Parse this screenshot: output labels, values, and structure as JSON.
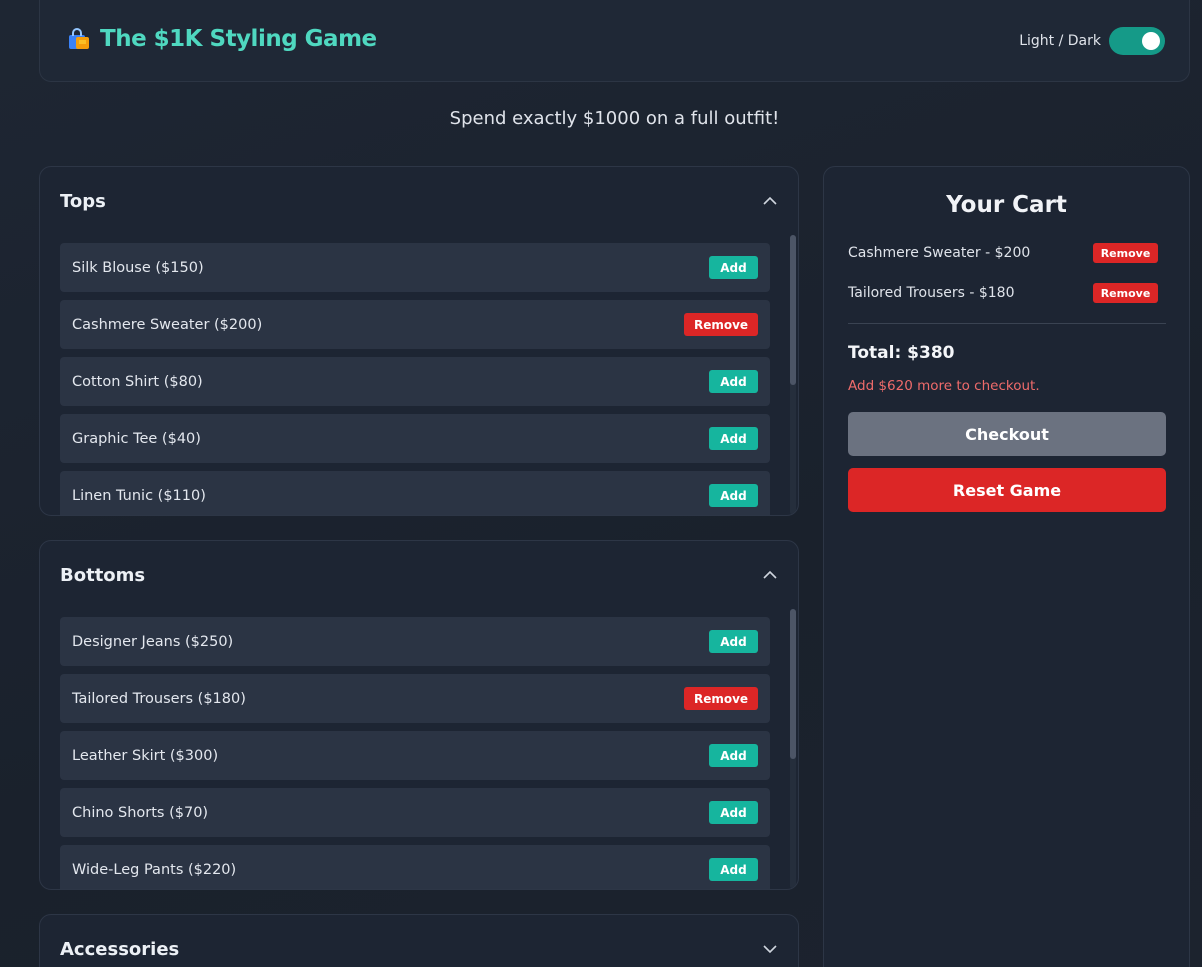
{
  "header": {
    "title": "The $1K Styling Game",
    "theme_label": "Light / Dark",
    "icon": "shopping-bag-icon"
  },
  "subtitle": "Spend exactly $1000 on a full outfit!",
  "categories": [
    {
      "title": "Tops",
      "expanded": true,
      "items": [
        {
          "label": "Silk Blouse ($150)",
          "action": "Add"
        },
        {
          "label": "Cashmere Sweater ($200)",
          "action": "Remove"
        },
        {
          "label": "Cotton Shirt ($80)",
          "action": "Add"
        },
        {
          "label": "Graphic Tee ($40)",
          "action": "Add"
        },
        {
          "label": "Linen Tunic ($110)",
          "action": "Add"
        }
      ]
    },
    {
      "title": "Bottoms",
      "expanded": true,
      "items": [
        {
          "label": "Designer Jeans ($250)",
          "action": "Add"
        },
        {
          "label": "Tailored Trousers ($180)",
          "action": "Remove"
        },
        {
          "label": "Leather Skirt ($300)",
          "action": "Add"
        },
        {
          "label": "Chino Shorts ($70)",
          "action": "Add"
        },
        {
          "label": "Wide-Leg Pants ($220)",
          "action": "Add"
        }
      ]
    },
    {
      "title": "Accessories",
      "expanded": false,
      "items": []
    }
  ],
  "cart": {
    "title": "Your Cart",
    "items": [
      {
        "label": "Cashmere Sweater - $200",
        "action": "Remove"
      },
      {
        "label": "Tailored Trousers - $180",
        "action": "Remove"
      }
    ],
    "total": "Total: $380",
    "warning": "Add $620 more to checkout.",
    "checkout_label": "Checkout",
    "reset_label": "Reset Game"
  },
  "colors": {
    "accent": "#16b59e",
    "title": "#4fd8c0",
    "danger": "#dc2626",
    "disabled": "#6b7280"
  }
}
